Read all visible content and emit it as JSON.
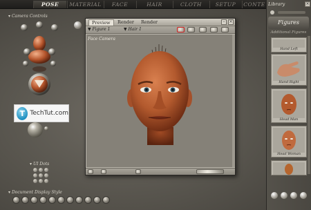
{
  "tabs": [
    {
      "label": "POSE",
      "active": true
    },
    {
      "label": "MATERIAL",
      "active": false
    },
    {
      "label": "FACE",
      "active": false
    },
    {
      "label": "HAIR",
      "active": false
    },
    {
      "label": "CLOTH",
      "active": false
    },
    {
      "label": "SETUP",
      "active": false
    },
    {
      "label": "CONTE",
      "active": false
    }
  ],
  "left_panel": {
    "camera_controls_label": "Camera Controls",
    "ui_dots_label": "UI Dots",
    "doc_display_label": "Document Display Style"
  },
  "logo": {
    "mark": "T",
    "text": "TechTut.com"
  },
  "preview": {
    "tabs": [
      {
        "label": "Preview",
        "active": true
      },
      {
        "label": "Render",
        "active": false
      },
      {
        "label": "Render",
        "active": false
      }
    ],
    "figure_selector": "▼ Figure 1",
    "element_selector": "▼ Hair 1",
    "viewport_label": "Face Camera"
  },
  "library": {
    "title": "Library",
    "header": "Figures",
    "subheader": "Additional Figures",
    "items": [
      {
        "caption": "Hand Left"
      },
      {
        "caption": "Hand Right"
      },
      {
        "caption": "Head Man"
      },
      {
        "caption": "Head Woman"
      }
    ]
  },
  "colors": {
    "skin": "#b5552c",
    "accent_red": "#d02020",
    "logo_blue": "#1f8fc0"
  }
}
